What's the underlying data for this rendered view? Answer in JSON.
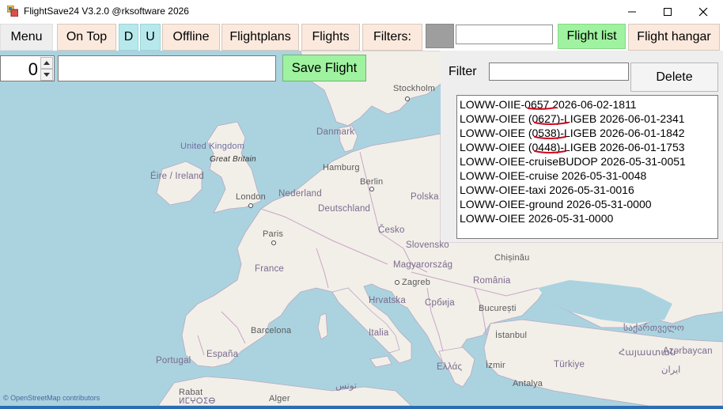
{
  "window": {
    "title": "FlightSave24 V3.2.0 @rksoftware 2026"
  },
  "toolbar": {
    "menu": "Menu",
    "on_top": "On Top",
    "d": "D",
    "u": "U",
    "offline": "Offline",
    "flightplans": "Flightplans",
    "flights": "Flights",
    "filters": "Filters:",
    "search_value": "",
    "flight_list": "Flight list",
    "flight_hangar": "Flight hangar"
  },
  "row2": {
    "number": "0",
    "flight_name_value": "",
    "save_flight": "Save Flight"
  },
  "panel": {
    "filter_label": "Filter",
    "filter_value": "",
    "delete": "Delete",
    "items": [
      "LOWW-OIIE-0657 2026-06-02-1811",
      "LOWW-OIEE (0627)-LIGEB 2026-06-01-2341",
      "LOWW-OIEE (0538)-LIGEB 2026-06-01-1842",
      "LOWW-OIEE (0448)-LIGEB 2026-06-01-1753",
      "LOWW-OIEE-cruiseBUDOP 2026-05-31-0051",
      "LOWW-OIEE-cruise 2026-05-31-0048",
      "LOWW-OIEE-taxi 2026-05-31-0016",
      "LOWW-OIEE-ground 2026-05-31-0000",
      "LOWW-OIEE 2026-05-31-0000"
    ]
  },
  "map": {
    "labels": {
      "stockholm": "Stockholm",
      "danmark": "Danmark",
      "united_kingdom": "United Kingdom",
      "great_britain": "Great Britain",
      "eire": "Éire / Ireland",
      "hamburg": "Hamburg",
      "berlin": "Berlin",
      "polska": "Polska",
      "nederland": "Nederland",
      "london": "London",
      "deutschland": "Deutschland",
      "cesko": "Česko",
      "paris": "Paris",
      "slovensko": "Slovensko",
      "chisinau": "Chișinău",
      "magyarorszag": "Magyarország",
      "france": "France",
      "zagreb": "Zagreb",
      "romania": "România",
      "hrvatska": "Hrvatska",
      "bucuresti": "București",
      "srbija": "Србија",
      "italia": "Italia",
      "barcelona": "Barcelona",
      "istanbul": "İstanbul",
      "georgia": "საქართველო",
      "portugal": "Portugal",
      "espana": "España",
      "armenia": "Հայաստան",
      "azerbaycan": "Azərbaycan",
      "ellas": "Ελλάς",
      "izmir": "İzmir",
      "turkiye": "Türkiye",
      "iran": "ایران",
      "tunisia": "تونس",
      "antalya": "Antalya",
      "rabat": "Rabat",
      "maroc": "ⵍⵎⵖⵔⵉⴱ",
      "alger": "Alger"
    },
    "attribution": "© OpenStreetMap contributors"
  },
  "colors": {
    "sea": "#aad3df",
    "land": "#f2efe9",
    "button_peach": "#fbe9dd",
    "button_teal": "#b7e9ec",
    "button_green": "#9ff29f",
    "annotation_red": "#d9001b"
  }
}
